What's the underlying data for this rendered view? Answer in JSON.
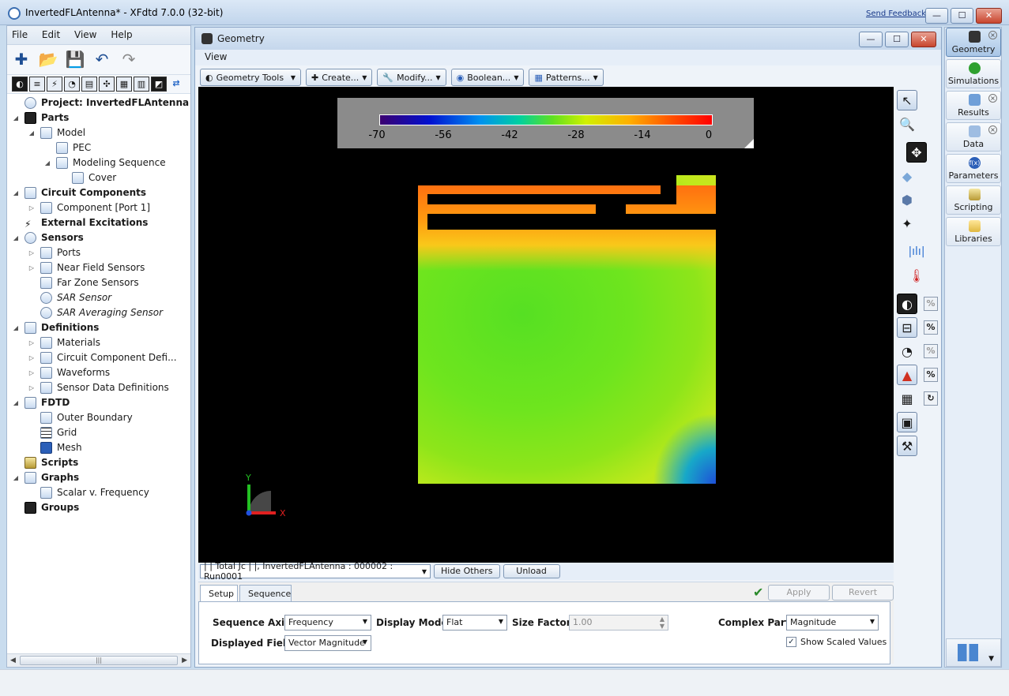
{
  "window": {
    "title": "InvertedFLAntenna* - XFdtd 7.0.0 (32-bit)",
    "feedback_link": "Send Feedback",
    "minimize": "—",
    "maximize": "☐",
    "close": "✕"
  },
  "menu": [
    "File",
    "Edit",
    "View",
    "Help"
  ],
  "tree": [
    {
      "label": "Project: InvertedFLAntenna",
      "depth": 0,
      "bold": true
    },
    {
      "label": "Parts",
      "depth": 0,
      "bold": true
    },
    {
      "label": "Model",
      "depth": 1
    },
    {
      "label": "PEC",
      "depth": 2
    },
    {
      "label": "Modeling Sequence",
      "depth": 2
    },
    {
      "label": "Cover",
      "depth": 3
    },
    {
      "label": "Circuit Components",
      "depth": 0,
      "bold": true
    },
    {
      "label": "Component [Port 1]",
      "depth": 1
    },
    {
      "label": "External Excitations",
      "depth": 0,
      "bold": true
    },
    {
      "label": "Sensors",
      "depth": 0,
      "bold": true
    },
    {
      "label": "Ports",
      "depth": 1
    },
    {
      "label": "Near Field Sensors",
      "depth": 1
    },
    {
      "label": "Far Zone Sensors",
      "depth": 1
    },
    {
      "label": "SAR Sensor",
      "depth": 1,
      "italic": true
    },
    {
      "label": "SAR Averaging Sensor",
      "depth": 1,
      "italic": true
    },
    {
      "label": "Definitions",
      "depth": 0,
      "bold": true
    },
    {
      "label": "Materials",
      "depth": 1
    },
    {
      "label": "Circuit Component Defi...",
      "depth": 1
    },
    {
      "label": "Waveforms",
      "depth": 1
    },
    {
      "label": "Sensor Data Definitions",
      "depth": 1
    },
    {
      "label": "FDTD",
      "depth": 0,
      "bold": true
    },
    {
      "label": "Outer Boundary",
      "depth": 1
    },
    {
      "label": "Grid",
      "depth": 1
    },
    {
      "label": "Mesh",
      "depth": 1
    },
    {
      "label": "Scripts",
      "depth": 0,
      "bold": true
    },
    {
      "label": "Graphs",
      "depth": 0,
      "bold": true
    },
    {
      "label": "Scalar v. Frequency",
      "depth": 1
    },
    {
      "label": "Groups",
      "depth": 0,
      "bold": true
    }
  ],
  "geometry": {
    "title": "Geometry",
    "view_menu": "View",
    "tools": {
      "geometry_tools": "Geometry Tools",
      "create": "Create...",
      "modify": "Modify...",
      "boolean": "Boolean...",
      "patterns": "Patterns..."
    },
    "colorbar": {
      "ticks": [
        "-70",
        "-56",
        "-42",
        "-28",
        "-14",
        "0"
      ]
    },
    "axes": {
      "x": "X",
      "y": "Y"
    }
  },
  "loadbar": {
    "result_select": "| | Total  Jc | |, InvertedFLAntenna : 000002 : Run0001",
    "hide_others": "Hide Others",
    "unload": "Unload"
  },
  "setup": {
    "tabs": [
      "Setup",
      "Sequence"
    ],
    "apply": "Apply",
    "revert": "Revert",
    "sequence_axis_label": "Sequence Axis:",
    "sequence_axis_value": "Frequency",
    "display_mode_label": "Display Mode:",
    "display_mode_value": "Flat",
    "size_factor_label": "Size Factor:",
    "size_factor_value": "1.00",
    "complex_part_label": "Complex Part:",
    "complex_part_value": "Magnitude",
    "displayed_field_label": "Displayed Field:",
    "displayed_field_value": "Vector Magnitude",
    "show_scaled_values": "Show Scaled Values"
  },
  "dock": [
    {
      "label": "Geometry",
      "active": true,
      "closable": true
    },
    {
      "label": "Simulations",
      "active": false,
      "closable": false
    },
    {
      "label": "Results",
      "active": false,
      "closable": true
    },
    {
      "label": "Data",
      "active": false,
      "closable": true
    },
    {
      "label": "Parameters",
      "active": false,
      "closable": false
    },
    {
      "label": "Scripting",
      "active": false,
      "closable": false
    },
    {
      "label": "Libraries",
      "active": false,
      "closable": false
    }
  ],
  "percent_label": "%",
  "colors": {
    "accent": "#3b6fb2",
    "viewport_bg": "#000000",
    "legend_bg": "#8b8b8b"
  }
}
